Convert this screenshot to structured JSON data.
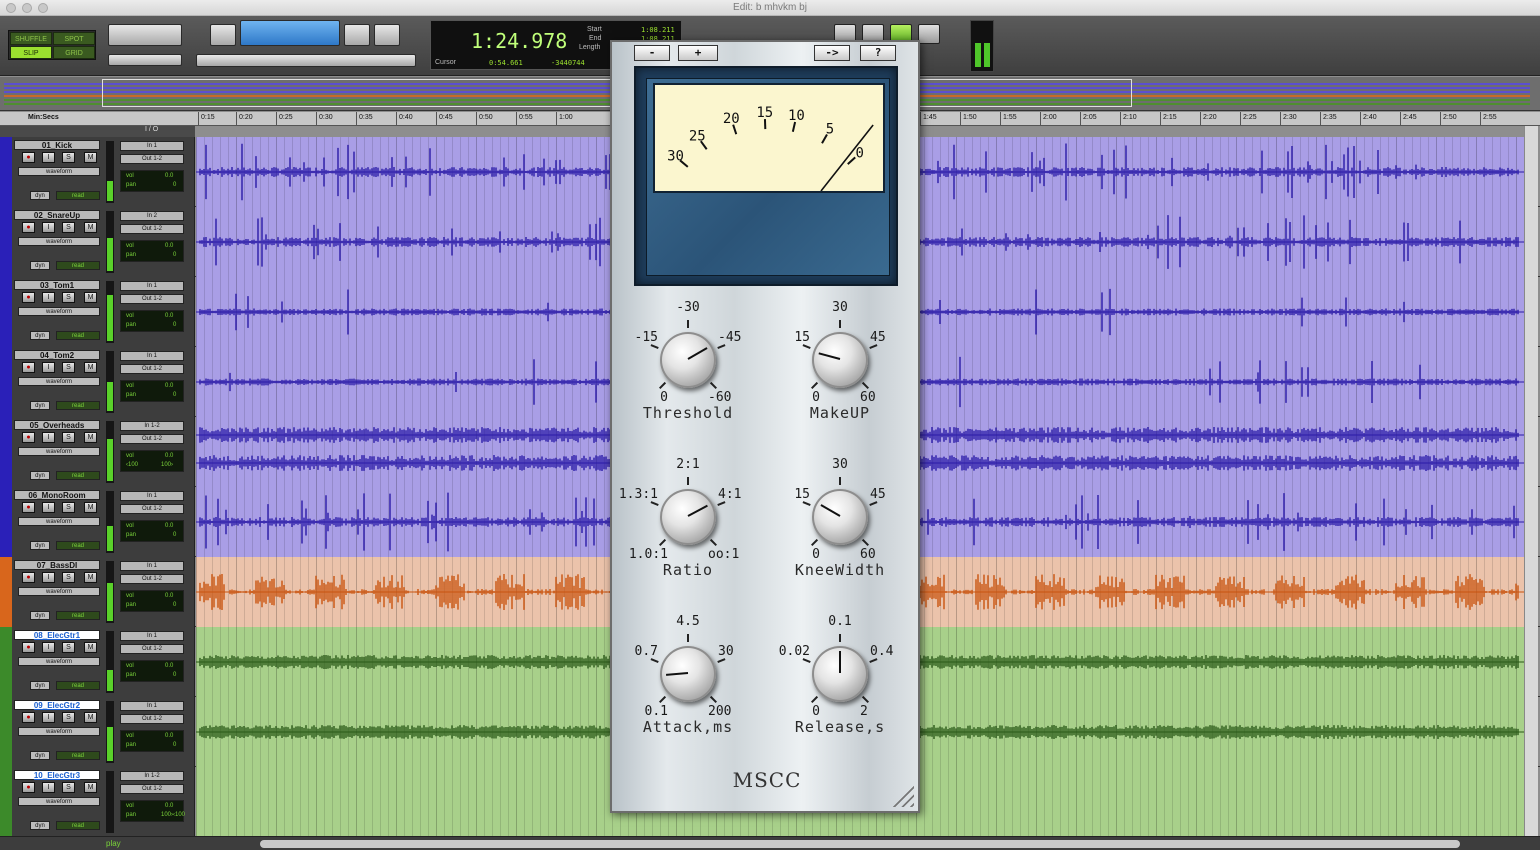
{
  "window": {
    "title": "Edit: b mhvkm bj"
  },
  "modes": [
    "SHUFFLE",
    "SPOT",
    "SLIP",
    "GRID"
  ],
  "counter": {
    "main": "1:24.978",
    "cursor_label": "Cursor",
    "cursor_value": "0:54.661",
    "sample_value": "-3440744",
    "start_label": "Start",
    "end_label": "End",
    "length_label": "Length",
    "start_value": "1:08.211",
    "end_value": "1:08.211",
    "length_value": "0:00.000"
  },
  "ruler": {
    "label": "Min:Secs",
    "ticks": [
      "0:15",
      "0:20",
      "0:25",
      "0:30",
      "0:35",
      "0:40",
      "0:45",
      "0:50",
      "0:55",
      "1:00",
      "1:45",
      "1:50",
      "1:55",
      "2:00",
      "2:05",
      "2:10",
      "2:15",
      "2:20",
      "2:25",
      "2:30",
      "2:35",
      "2:40",
      "2:45",
      "2:50",
      "2:55"
    ]
  },
  "io_header": "I / O",
  "track_labels": {
    "solo": "S",
    "mute": "M",
    "rec": "●",
    "input": "I",
    "view": "waveform",
    "dyn": "dyn",
    "read": "read",
    "vol": "vol",
    "pan": "pan"
  },
  "tracks": [
    {
      "name": "01_Kick",
      "in": "In 1",
      "out": "Out 1-2",
      "vol": "0.0",
      "pan": "0",
      "pan2": "",
      "kind": "mono",
      "color": "#2a20b8",
      "bg": "#a99ee6",
      "wave": "#2a1aa8",
      "selected": false
    },
    {
      "name": "02_SnareUp",
      "in": "In 2",
      "out": "Out 1-2",
      "vol": "0.0",
      "pan": "0",
      "pan2": "",
      "kind": "mono",
      "color": "#2a20b8",
      "bg": "#a99ee6",
      "wave": "#2a1aa8",
      "selected": false
    },
    {
      "name": "03_Tom1",
      "in": "In 1",
      "out": "Out 1-2",
      "vol": "0.0",
      "pan": "0",
      "pan2": "",
      "kind": "mono",
      "color": "#2a20b8",
      "bg": "#a99ee6",
      "wave": "#2a1aa8",
      "selected": false
    },
    {
      "name": "04_Tom2",
      "in": "In 1",
      "out": "Out 1-2",
      "vol": "0.0",
      "pan": "0",
      "pan2": "",
      "kind": "mono",
      "color": "#2a20b8",
      "bg": "#a99ee6",
      "wave": "#2a1aa8",
      "selected": false
    },
    {
      "name": "05_Overheads",
      "in": "In 1-2",
      "out": "Out 1-2",
      "vol": "0.0",
      "pan": "‹100",
      "pan2": "100›",
      "kind": "stereo",
      "color": "#2a20b8",
      "bg": "#a99ee6",
      "wave": "#2a1aa8",
      "selected": false
    },
    {
      "name": "06_MonoRoom",
      "in": "In 1",
      "out": "Out 1-2",
      "vol": "0.0",
      "pan": "0",
      "pan2": "",
      "kind": "mono",
      "color": "#2a20b8",
      "bg": "#a99ee6",
      "wave": "#2a1aa8",
      "selected": false
    },
    {
      "name": "07_BassDI",
      "in": "In 1",
      "out": "Out 1-2",
      "vol": "0.0",
      "pan": "0",
      "pan2": "",
      "kind": "mono",
      "color": "#d8661c",
      "bg": "#ebc3ab",
      "wave": "#c9530e",
      "selected": false
    },
    {
      "name": "08_ElecGtr1",
      "in": "In 1",
      "out": "Out 1-2",
      "vol": "0.0",
      "pan": "0",
      "pan2": "",
      "kind": "mono",
      "color": "#3c8a2a",
      "bg": "#a8d08a",
      "wave": "#2a5a18",
      "selected": true
    },
    {
      "name": "09_ElecGtr2",
      "in": "In 1",
      "out": "Out 1-2",
      "vol": "0.0",
      "pan": "0",
      "pan2": "",
      "kind": "mono",
      "color": "#3c8a2a",
      "bg": "#a8d08a",
      "wave": "#2a5a18",
      "selected": true
    },
    {
      "name": "10_ElecGtr3",
      "in": "In 1-2",
      "out": "Out 1-2",
      "vol": "0.0",
      "pan": "‹100",
      "pan2": "100›",
      "kind": "empty",
      "color": "#3c8a2a",
      "bg": "#a8d08a",
      "wave": "#2a5a18",
      "selected": true
    }
  ],
  "transport_status": "play",
  "plugin": {
    "buttons": [
      "-",
      "+",
      "->",
      "?"
    ],
    "meter_scale": [
      "30",
      "25",
      "20",
      "15",
      "10",
      "5",
      "0"
    ],
    "meter_value_db": 0,
    "brand": "MSCC",
    "knobs": [
      {
        "name": "Threshold",
        "labels": {
          "top": "-30",
          "left": "-15",
          "right": "-45",
          "bl": "0",
          "br": "-60"
        },
        "value": "-40"
      },
      {
        "name": "MakeUP",
        "labels": {
          "top": "30",
          "left": "15",
          "right": "45",
          "bl": "0",
          "br": "60"
        },
        "value": "13"
      },
      {
        "name": "Ratio",
        "labels": {
          "top": "2:1",
          "left": "1.3:1",
          "right": "4:1",
          "bl": "1.0:1",
          "br": "oo:1"
        },
        "value": "4:1"
      },
      {
        "name": "KneeWidth",
        "labels": {
          "top": "30",
          "left": "15",
          "right": "45",
          "bl": "0",
          "br": "60"
        },
        "value": "18"
      },
      {
        "name": "Attack,ms",
        "labels": {
          "top": "4.5",
          "left": "0.7",
          "right": "30",
          "bl": "0.1",
          "br": "200"
        },
        "value": "0.6"
      },
      {
        "name": "Release,s",
        "labels": {
          "top": "0.1",
          "left": "0.02",
          "right": "0.4",
          "bl": "0",
          "br": "2"
        },
        "value": "0.1"
      }
    ]
  },
  "colors": {
    "accent": "#9be02f",
    "counter_text": "#c0ff7a",
    "vu_face": "#fbf6cf",
    "vu_frame": "#2b5478"
  }
}
